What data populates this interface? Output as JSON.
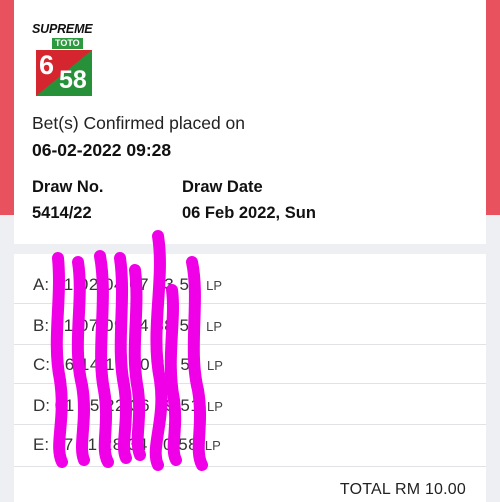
{
  "logo": {
    "brand": "SUPREME",
    "sub": "TOTO",
    "game_left": "6",
    "game_right": "58"
  },
  "ticket": {
    "confirm_text": "Bet(s) Confirmed placed on",
    "placed_datetime": "06-02-2022 09:28",
    "draw_no_label": "Draw No.",
    "draw_no": "5414/22",
    "draw_date_label": "Draw Date",
    "draw_date": "06 Feb 2022, Sun"
  },
  "bets": [
    {
      "label": "A:",
      "numbers": "01 02 04 07 13 58",
      "type": "LP"
    },
    {
      "label": "B:",
      "numbers": "01 07 09 14 38 51",
      "type": "LP"
    },
    {
      "label": "C:",
      "numbers": "06 14 16 20 39 58",
      "type": "LP"
    },
    {
      "label": "D:",
      "numbers": "01 15 22 36 39 51",
      "type": "LP"
    },
    {
      "label": "E:",
      "numbers": "07 11 28 34 40 58",
      "type": "LP"
    }
  ],
  "total": "TOTAL RM 10.00",
  "colors": {
    "header_red": "#e8525e",
    "redaction": "#f000e6",
    "logo_green": "#2e9a3f",
    "logo_red": "#d5262f"
  }
}
